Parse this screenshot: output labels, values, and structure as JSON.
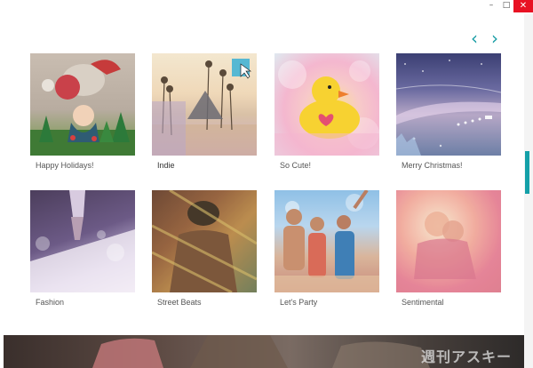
{
  "window": {
    "controls": {
      "minimize": "–",
      "maximize": "□",
      "close": "✕"
    }
  },
  "nav": {
    "prev_icon": "chevron-left-icon",
    "next_icon": "chevron-right-icon",
    "prev_glyph": "‹",
    "next_glyph": "›",
    "accent": "#1b9ea6"
  },
  "gallery": {
    "items": [
      {
        "label": "Happy Holidays!"
      },
      {
        "label": "Indie",
        "hovered": true
      },
      {
        "label": "So Cute!"
      },
      {
        "label": "Merry Christmas!"
      },
      {
        "label": "Fashion"
      },
      {
        "label": "Street Beats"
      },
      {
        "label": "Let's Party"
      },
      {
        "label": "Sentimental"
      }
    ]
  },
  "footer": {
    "watermark": "週刊アスキー"
  },
  "colors": {
    "scrollbar": "#14a0a8",
    "close_button": "#e81123"
  }
}
